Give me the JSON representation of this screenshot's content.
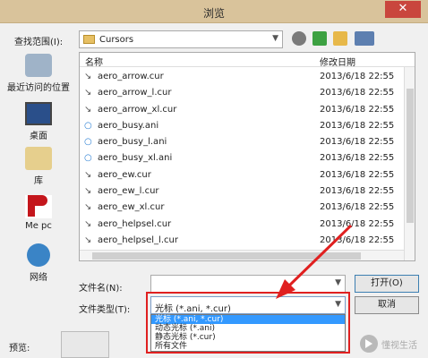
{
  "window": {
    "title": "浏览",
    "close_glyph": "✕"
  },
  "toolbar": {
    "look_in_label": "查找范围(I):",
    "look_in_value": "Cursors",
    "icons": [
      "back-icon",
      "up-folder-icon",
      "new-folder-icon",
      "view-menu-icon"
    ]
  },
  "places": [
    {
      "label": "最近访问的位置",
      "icon": "recent-places-icon"
    },
    {
      "label": "桌面",
      "icon": "desktop-icon"
    },
    {
      "label": "库",
      "icon": "libraries-icon"
    },
    {
      "label": "Me pc",
      "icon": "computer-icon"
    },
    {
      "label": "网络",
      "icon": "network-icon"
    }
  ],
  "file_list": {
    "columns": [
      "名称",
      "修改日期"
    ],
    "rows": [
      {
        "name": "aero_arrow.cur",
        "date": "2013/6/18 22:55"
      },
      {
        "name": "aero_arrow_l.cur",
        "date": "2013/6/18 22:55"
      },
      {
        "name": "aero_arrow_xl.cur",
        "date": "2013/6/18 22:55"
      },
      {
        "name": "aero_busy.ani",
        "date": "2013/6/18 22:55"
      },
      {
        "name": "aero_busy_l.ani",
        "date": "2013/6/18 22:55"
      },
      {
        "name": "aero_busy_xl.ani",
        "date": "2013/6/18 22:55"
      },
      {
        "name": "aero_ew.cur",
        "date": "2013/6/18 22:55"
      },
      {
        "name": "aero_ew_l.cur",
        "date": "2013/6/18 22:55"
      },
      {
        "name": "aero_ew_xl.cur",
        "date": "2013/6/18 22:55"
      },
      {
        "name": "aero_helpsel.cur",
        "date": "2013/6/18 22:55"
      },
      {
        "name": "aero_helpsel_l.cur",
        "date": "2013/6/18 22:55"
      }
    ]
  },
  "filename": {
    "label": "文件名(N):",
    "value": ""
  },
  "filetype": {
    "label": "文件类型(T):",
    "selected": "光标 (*.ani, *.cur)",
    "options": [
      "光标 (*.ani, *.cur)",
      "动态光标 (*.ani)",
      "静态光标 (*.cur)",
      "所有文件"
    ]
  },
  "buttons": {
    "open": "打开(O)",
    "cancel": "取消"
  },
  "preview": {
    "label": "预览:"
  },
  "watermark": {
    "text": "懂视生活"
  },
  "colors": {
    "highlight": "#e02020",
    "selection": "#3399ff"
  }
}
